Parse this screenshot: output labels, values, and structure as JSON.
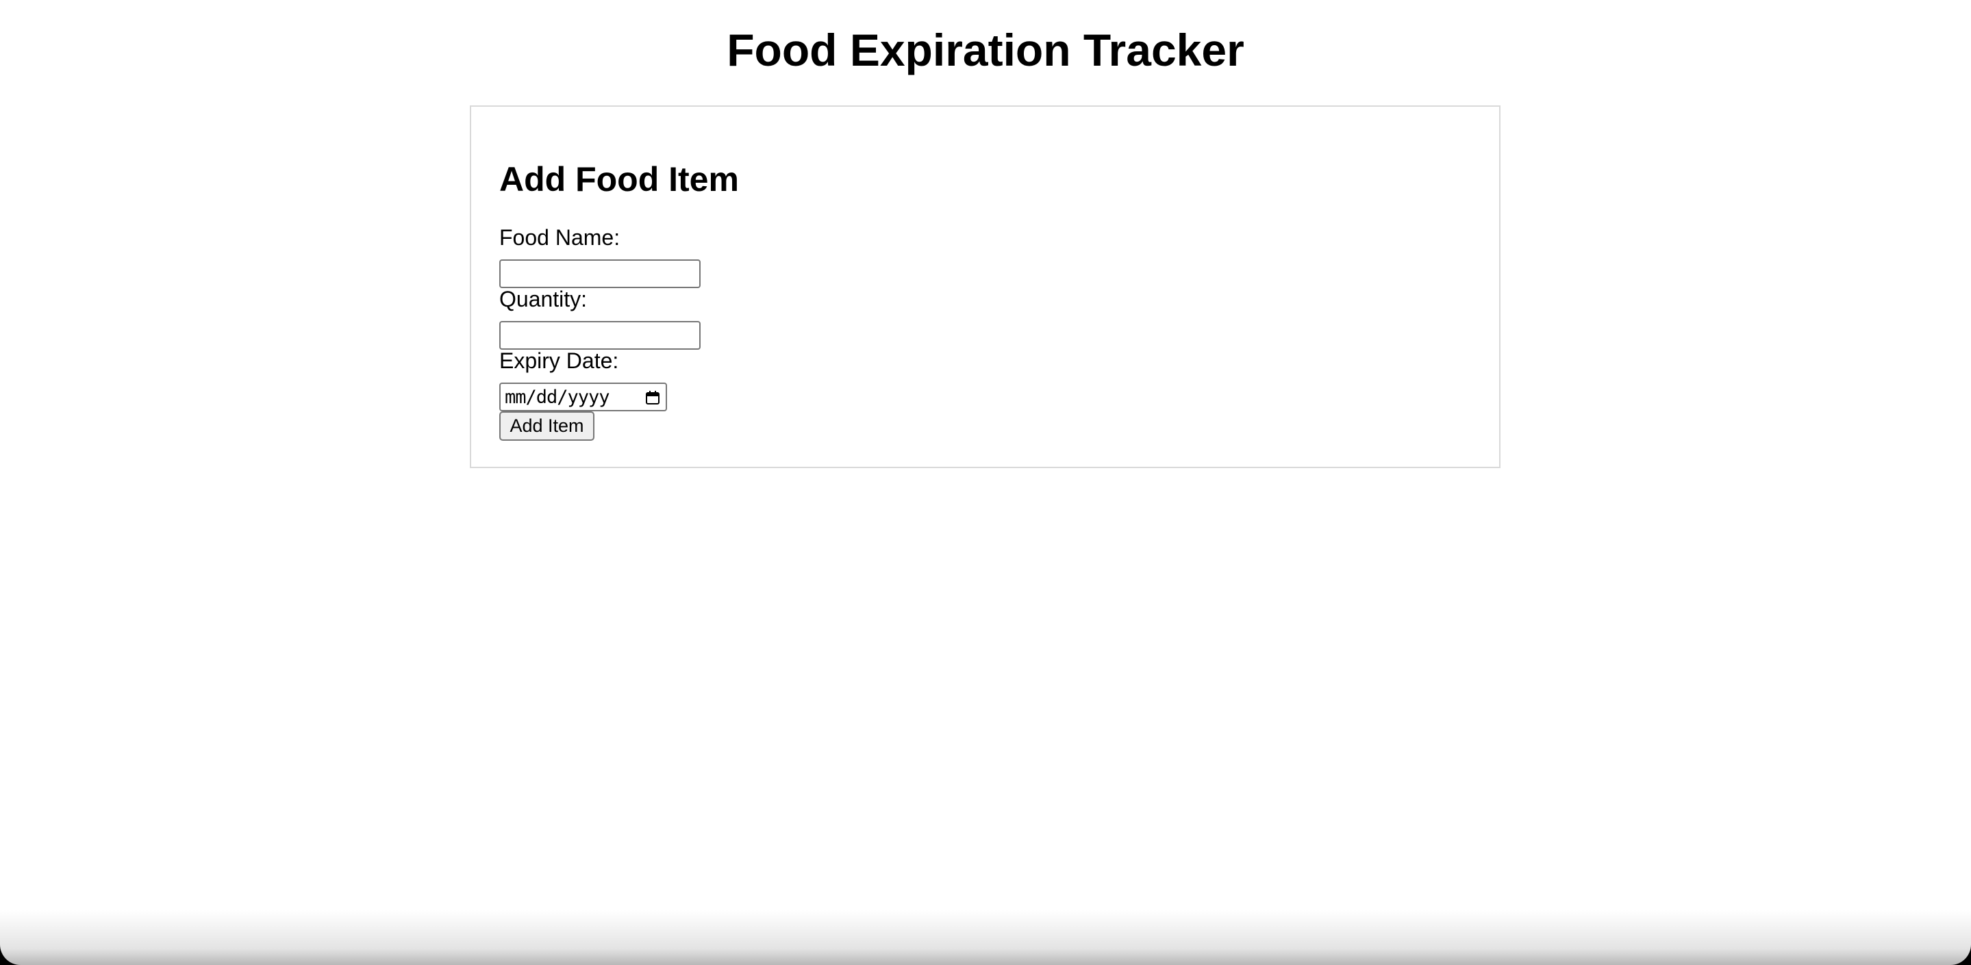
{
  "page": {
    "title": "Food Expiration Tracker"
  },
  "form": {
    "heading": "Add Food Item",
    "food_name": {
      "label": "Food Name:",
      "value": "",
      "placeholder": ""
    },
    "quantity": {
      "label": "Quantity:",
      "value": "",
      "placeholder": ""
    },
    "expiry_date": {
      "label": "Expiry Date:",
      "placeholder": "mm/dd/yyyy",
      "icon": "calendar-icon"
    },
    "submit_label": "Add Item"
  },
  "colors": {
    "background": "#ffffff",
    "card_border": "#d9d9d9",
    "input_border": "#767676",
    "button_background": "#efefef",
    "text": "#000000"
  }
}
